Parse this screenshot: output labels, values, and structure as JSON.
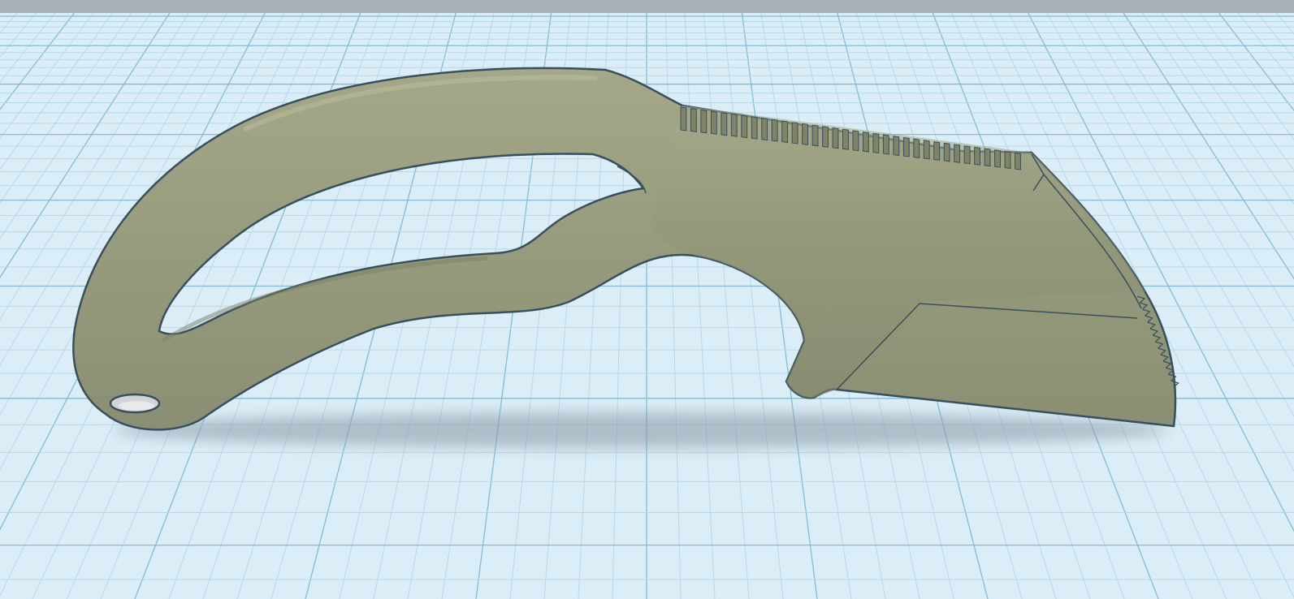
{
  "scene": {
    "view": "3d-workplane",
    "object": "knife-model",
    "colors": {
      "top_bar": "#a9b1b6",
      "workplane": "#dbedf6",
      "grid_minor": "#b4d7e8",
      "grid_major": "#84bcd6",
      "model_fill": "#8f9478",
      "model_highlight": "#a8ac8c",
      "model_edge": "#3a4f5e",
      "shadow": "#8a99a6"
    }
  }
}
